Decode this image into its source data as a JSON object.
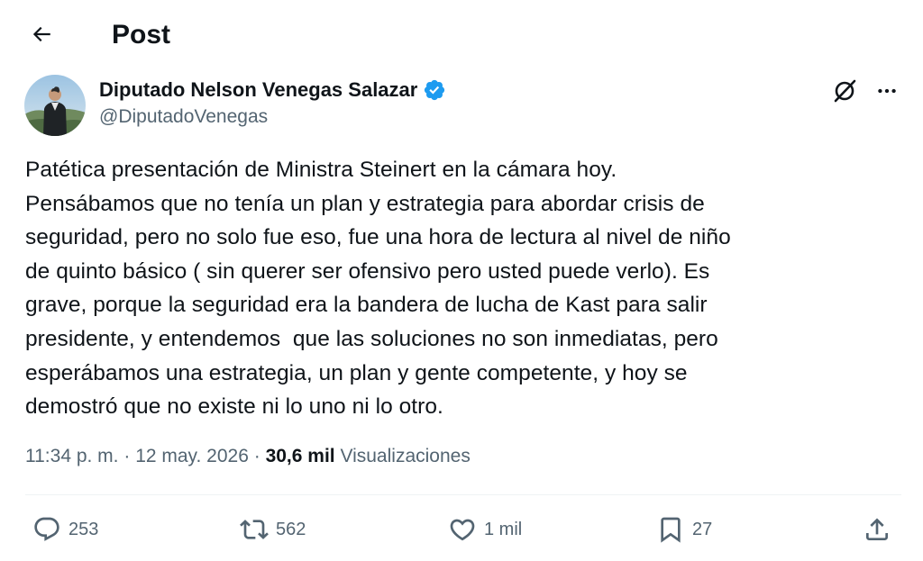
{
  "header": {
    "title": "Post"
  },
  "icons": {
    "back": "arrow-left-icon",
    "verified": "verified-badge-icon",
    "grok": "grok-icon",
    "more": "more-icon",
    "reply": "reply-icon",
    "repost": "repost-icon",
    "like": "like-icon",
    "bookmark": "bookmark-icon",
    "share": "share-icon"
  },
  "colors": {
    "verified": "#1d9bf0",
    "secondary_text": "#536471",
    "primary_text": "#0f1419"
  },
  "author": {
    "name": "Diputado Nelson Venegas Salazar",
    "handle": "@DiputadoVenegas"
  },
  "post": {
    "text": "Patética presentación de Ministra Steinert en la cámara hoy.\nPensábamos que no tenía un plan y estrategia para abordar crisis de\nseguridad, pero no solo fue eso, fue una hora de lectura al nivel de niño\nde quinto básico ( sin querer ser ofensivo pero usted puede verlo). Es\ngrave, porque la seguridad era la bandera de lucha de Kast para salir\npresidente, y entendemos  que las soluciones no son inmediatas, pero\nesperábamos una estrategia, un plan y gente competente, y hoy se\ndemostró que no existe ni lo uno ni lo otro.",
    "time": "11:34 p. m.",
    "separator": " · ",
    "date": "12 may. 2026",
    "views_count": "30,6 mil",
    "views_label": " Visualizaciones"
  },
  "actions": {
    "replies": "253",
    "reposts": "562",
    "likes": "1 mil",
    "bookmarks": "27"
  }
}
